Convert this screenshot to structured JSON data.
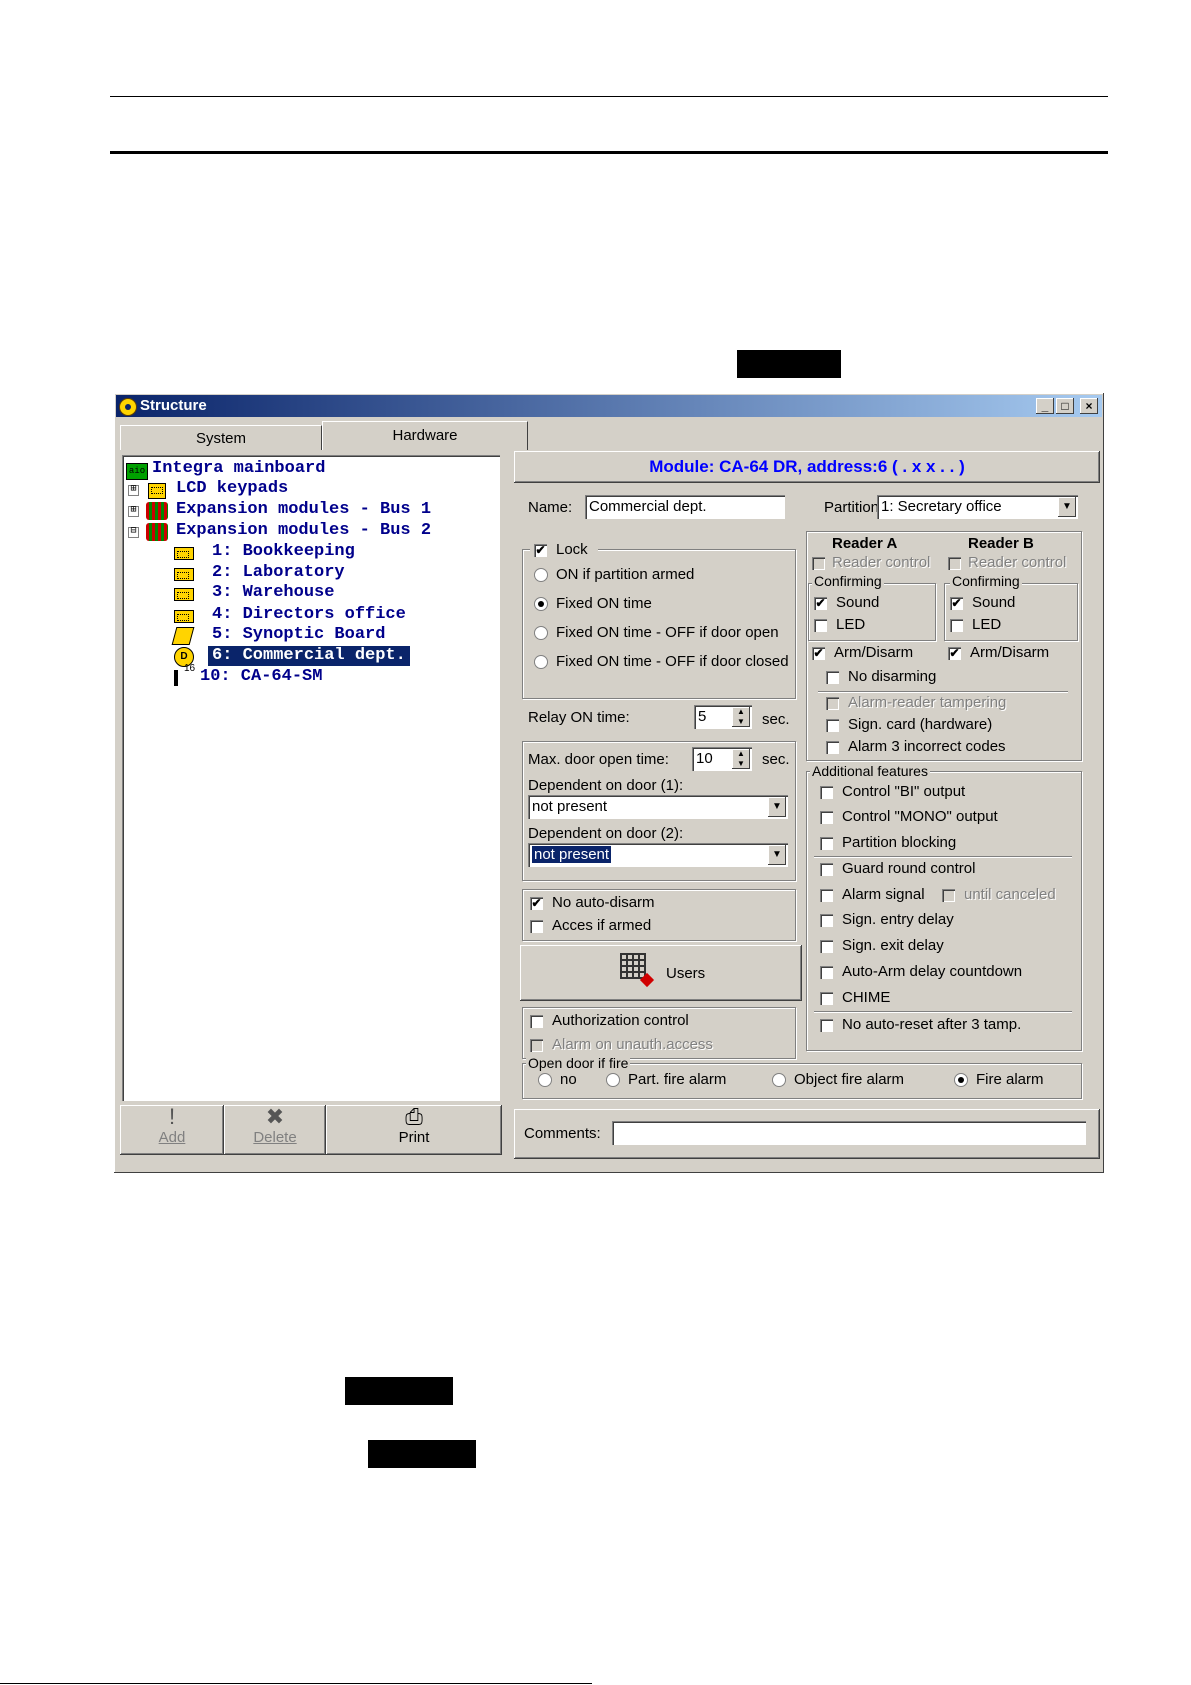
{
  "window": {
    "title": "Structure",
    "controls": {
      "minimize": "_",
      "maximize": "□",
      "close": "×"
    }
  },
  "tabs": [
    {
      "label": "System"
    },
    {
      "label": "Hardware"
    }
  ],
  "tree": {
    "items": [
      {
        "label": "Integra mainboard"
      },
      {
        "label": "LCD keypads"
      },
      {
        "label": "Expansion modules - Bus 1"
      },
      {
        "label": "Expansion modules - Bus 2"
      },
      {
        "label": "1: Bookkeeping"
      },
      {
        "label": "2: Laboratory"
      },
      {
        "label": "3: Warehouse"
      },
      {
        "label": "4: Directors office"
      },
      {
        "label": "5: Synoptic Board"
      },
      {
        "label": "6: Commercial dept."
      },
      {
        "label": "10: CA-64-SM"
      }
    ],
    "mainboard_icon_text": "aio",
    "sm_badge": "16",
    "expanded_mark": "⊟",
    "collapsed_mark": "⊞"
  },
  "toolbar": {
    "add_label": "Add",
    "delete_label": "Delete",
    "print_label": "Print"
  },
  "module_header": "Module: CA-64 DR, address:6 ( . x x . . )",
  "name": {
    "label": "Name:",
    "value": "Commercial dept."
  },
  "partition": {
    "label": "Partition",
    "value": "1: Secretary office"
  },
  "lock": {
    "label": "Lock",
    "checked": "✔",
    "options": [
      {
        "label": "ON if partition armed"
      },
      {
        "label": "Fixed ON time"
      },
      {
        "label": "Fixed ON time - OFF if door open"
      },
      {
        "label": "Fixed ON time - OFF if door closed"
      }
    ]
  },
  "relay": {
    "label": "Relay ON time:",
    "value": "5",
    "unit": "sec."
  },
  "door": {
    "max_label": "Max. door open time:",
    "max_value": "10",
    "unit": "sec.",
    "dep1_label": "Dependent on door (1):",
    "dep1_value": "not present",
    "dep2_label": "Dependent on door (2):",
    "dep2_value": "not present"
  },
  "misc": {
    "no_auto_disarm": "No auto-disarm",
    "acces_if_armed": "Acces if armed"
  },
  "users_button": "Users",
  "auth": {
    "authorization_control": "Authorization control",
    "alarm_unauth": "Alarm on unauth.access"
  },
  "reader_a": {
    "title": "Reader A",
    "reader_control": "Reader control",
    "confirming": "Confirming",
    "sound": "Sound",
    "led": "LED",
    "arm_disarm": "Arm/Disarm"
  },
  "reader_b": {
    "title": "Reader B",
    "reader_control": "Reader control",
    "confirming": "Confirming",
    "sound": "Sound",
    "led": "LED",
    "arm_disarm": "Arm/Disarm"
  },
  "reader_common": {
    "no_disarming": "No disarming",
    "alarm_reader_tampering": "Alarm-reader tampering",
    "sign_card": "Sign. card (hardware)",
    "alarm_3_codes": "Alarm 3 incorrect codes"
  },
  "additional": {
    "title": "Additional features",
    "control_bi": "Control \"BI\" output",
    "control_mono": "Control \"MONO\" output",
    "partition_blocking": "Partition blocking",
    "guard_round": "Guard round control",
    "alarm_signal": "Alarm signal",
    "until_canceled": "until canceled",
    "sign_entry": "Sign. entry delay",
    "sign_exit": "Sign. exit delay",
    "auto_arm": "Auto-Arm delay countdown",
    "chime": "CHIME",
    "no_auto_reset": "No auto-reset after 3 tamp."
  },
  "fire": {
    "title": "Open door if fire",
    "options": [
      {
        "label": "no"
      },
      {
        "label": "Part. fire alarm"
      },
      {
        "label": "Object fire alarm"
      },
      {
        "label": "Fire alarm"
      }
    ]
  },
  "comments": {
    "label": "Comments:",
    "value": ""
  },
  "colors": {
    "title_bar": "#0a246a",
    "tree_text": "#00008b",
    "header_text": "#0000ff",
    "face": "#d4d0c8"
  }
}
